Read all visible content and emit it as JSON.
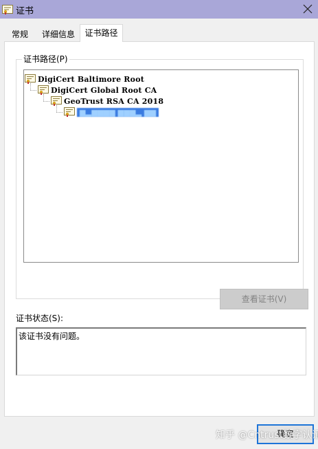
{
  "window": {
    "title": "证书",
    "close_icon": "close-icon"
  },
  "tabs": [
    {
      "label": "常规",
      "selected": false
    },
    {
      "label": "详细信息",
      "selected": false
    },
    {
      "label": "证书路径",
      "selected": true
    }
  ],
  "cert_path": {
    "group_label": "证书路径(P)",
    "nodes": [
      {
        "label": "DigiCert Baltimore Root",
        "level": 0
      },
      {
        "label": "DigiCert Global Root CA",
        "level": 1
      },
      {
        "label": "GeoTrust RSA CA 2018",
        "level": 2
      },
      {
        "label": "",
        "level": 3,
        "selected": true,
        "redacted": true
      }
    ],
    "view_button_label": "查看证书(V)",
    "view_button_enabled": false
  },
  "status": {
    "label": "证书状态(S):",
    "text": "该证书没有问题。"
  },
  "footer": {
    "ok_label": "确定",
    "watermark": "知乎 @Cntrust数字认证"
  },
  "colors": {
    "titlebar": "#a9a7d8",
    "selection": "#3a7be0",
    "ok_border": "#1d74d8"
  }
}
